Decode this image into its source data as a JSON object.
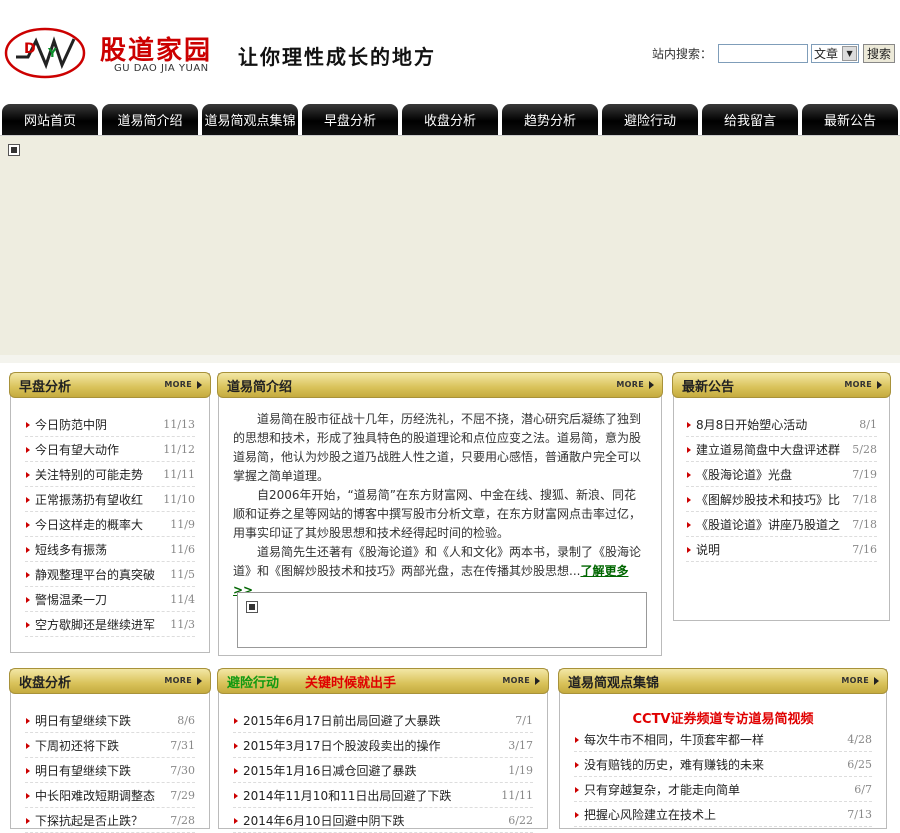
{
  "header": {
    "logo_cn": "股道家园",
    "logo_en": "GU DAO JIA YUAN",
    "slogan": "让你理性成长的地方",
    "search_label": "站内搜索：",
    "search_select": "文章",
    "search_button": "搜索"
  },
  "nav": [
    "网站首页",
    "道易简介绍",
    "道易简观点集锦",
    "早盘分析",
    "收盘分析",
    "趋势分析",
    "避险行动",
    "给我留言",
    "最新公告"
  ],
  "more_label": "MORE",
  "morning": {
    "title": "早盘分析",
    "items": [
      {
        "t": "今日防范中阴",
        "d": "11/13"
      },
      {
        "t": "今日有望大动作",
        "d": "11/12"
      },
      {
        "t": "关注特别的可能走势",
        "d": "11/11"
      },
      {
        "t": "正常振荡扔有望收红",
        "d": "11/10"
      },
      {
        "t": "今日这样走的概率大",
        "d": "11/9"
      },
      {
        "t": "短线多有振荡",
        "d": "11/6"
      },
      {
        "t": "静观整理平台的真突破",
        "d": "11/5"
      },
      {
        "t": "警惕温柔一刀",
        "d": "11/4"
      },
      {
        "t": "空方歇脚还是继续进军",
        "d": "11/3"
      }
    ]
  },
  "intro": {
    "title": "道易简介绍",
    "p1": "道易简在股市征战十几年，历经洗礼，不屈不挠，潜心研究后凝练了独到的思想和技术，形成了独具特色的股道理论和点位应变之法。道易简，意为股道易简，他认为炒股之道乃战胜人性之道，只要用心感悟，普通散户完全可以掌握之简单道理。",
    "p2": "自2006年开始，“道易简”在东方财富网、中金在线、搜狐、新浪、同花顺和证券之星等网站的博客中撰写股市分析文章，在东方财富网点击率过亿，用事实印证了其炒股思想和技术经得起时间的检验。",
    "p3": "道易简先生还著有《股海论道》和《人和文化》两本书，录制了《股海论道》和《图解炒股技术和技巧》两部光盘，志在传播其炒股思想...",
    "more": "了解更多>>"
  },
  "notice": {
    "title": "最新公告",
    "items": [
      {
        "t": "8月8日开始塑心活动",
        "d": "8/1"
      },
      {
        "t": "建立道易简盘中大盘评述群",
        "d": "5/28"
      },
      {
        "t": "《股海论道》光盘",
        "d": "7/19"
      },
      {
        "t": "《图解炒股技术和技巧》比",
        "d": "7/18"
      },
      {
        "t": "《股道论道》讲座乃股道之",
        "d": "7/18"
      },
      {
        "t": "说明",
        "d": "7/16"
      }
    ]
  },
  "closing": {
    "title": "收盘分析",
    "items": [
      {
        "t": "明日有望继续下跌",
        "d": "8/6"
      },
      {
        "t": "下周初还将下跌",
        "d": "7/31"
      },
      {
        "t": "明日有望继续下跌",
        "d": "7/30"
      },
      {
        "t": "中长阳难改短期调整态",
        "d": "7/29"
      },
      {
        "t": "下探抗起是否止跌？",
        "d": "7/28"
      }
    ]
  },
  "hedge": {
    "title": "避险行动",
    "subtitle": "关键时候就出手",
    "items": [
      {
        "t": "2015年6月17日前出局回避了大暴跌",
        "d": "7/1"
      },
      {
        "t": "2015年3月17日个股波段卖出的操作",
        "d": "3/17"
      },
      {
        "t": "2015年1月16日减仓回避了暴跌",
        "d": "1/19"
      },
      {
        "t": "2014年11月10和11日出局回避了下跌",
        "d": "11/11"
      },
      {
        "t": "2014年6月10日回避中阴下跌",
        "d": "6/22"
      }
    ]
  },
  "views": {
    "title": "道易简观点集锦",
    "headline": "CCTV证券频道专访道易简视频",
    "items": [
      {
        "t": "每次牛市不相同，牛顶套牢都一样",
        "d": "4/28"
      },
      {
        "t": "没有赔钱的历史，难有赚钱的未来",
        "d": "6/25"
      },
      {
        "t": "只有穿越复杂，才能走向简单",
        "d": "6/7"
      },
      {
        "t": "把握心风险建立在技术上",
        "d": "7/13"
      }
    ]
  },
  "colors": {
    "accent": "#cc0000",
    "nav_bg": "#000000",
    "panel_head": "#d9c25a",
    "green_link": "#006600"
  }
}
